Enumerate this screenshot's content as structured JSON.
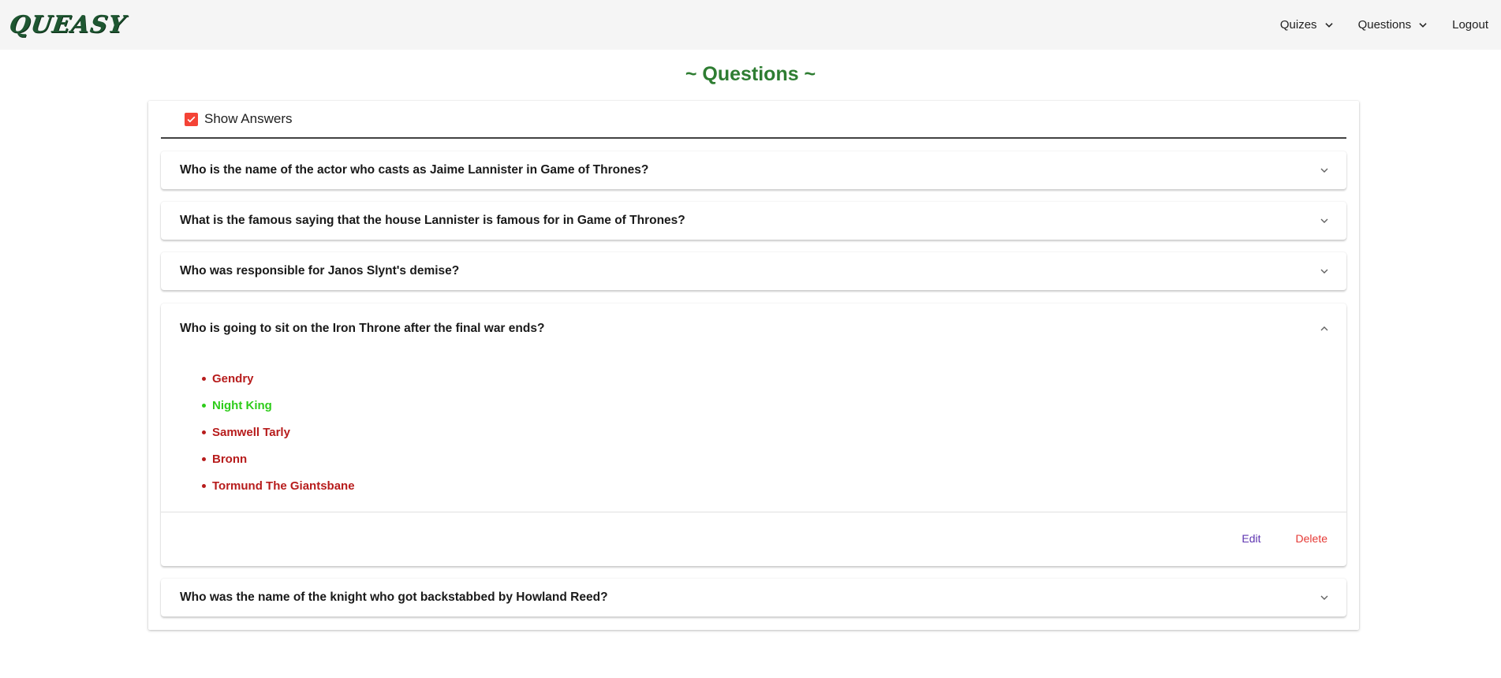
{
  "header": {
    "logo": "QUEASY",
    "nav": [
      {
        "label": "Quizes",
        "icon": "chevron-down-icon"
      },
      {
        "label": "Questions",
        "icon": "chevron-down-icon"
      },
      {
        "label": "Logout"
      }
    ]
  },
  "page": {
    "title": "~ Questions ~"
  },
  "toggle": {
    "label": "Show Answers",
    "checked": true
  },
  "questions": [
    {
      "text": "Who is the name of the actor who casts as Jaime Lannister in Game of Thrones?",
      "expanded": false
    },
    {
      "text": "What is the famous saying that the house Lannister is famous for in Game of Thrones?",
      "expanded": false
    },
    {
      "text": "Who was responsible for Janos Slynt's demise?",
      "expanded": false
    },
    {
      "text": "Who is going to sit on the Iron Throne after the final war ends?",
      "expanded": true,
      "answers": [
        {
          "text": "Gendry",
          "correct": false
        },
        {
          "text": "Night King",
          "correct": true
        },
        {
          "text": "Samwell Tarly",
          "correct": false
        },
        {
          "text": "Bronn",
          "correct": false
        },
        {
          "text": "Tormund The Giantsbane",
          "correct": false
        }
      ],
      "actions": {
        "edit": "Edit",
        "delete": "Delete"
      }
    },
    {
      "text": "Who was the name of the knight who got backstabbed by Howland Reed?",
      "expanded": false
    }
  ],
  "colors": {
    "title": "#2e7d32",
    "correct": "#2ecc1a",
    "incorrect": "#b71c1c",
    "edit": "#5e35b1",
    "delete": "#e53935",
    "checkbox": "#f44336"
  }
}
